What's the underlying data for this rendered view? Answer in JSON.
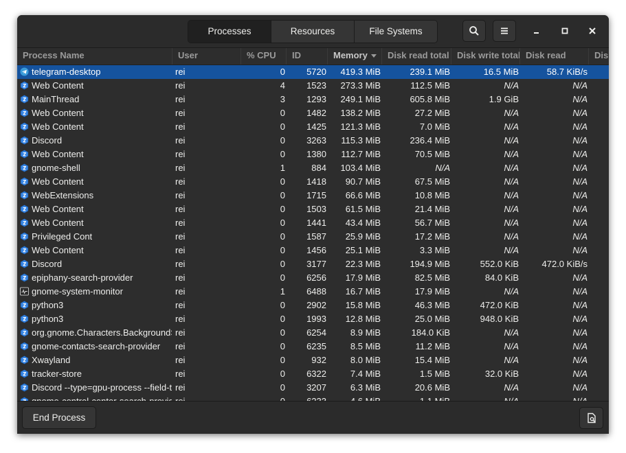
{
  "tabs": [
    "Processes",
    "Resources",
    "File Systems"
  ],
  "active_tab": "Processes",
  "header_buttons": {
    "search_icon": "search-icon",
    "menu_icon": "hamburger-menu-icon"
  },
  "window_controls": {
    "minimize": "minimize-icon",
    "maximize": "maximize-icon",
    "close": "close-icon"
  },
  "columns": [
    "Process Name",
    "User",
    "% CPU",
    "ID",
    "Memory",
    "Disk read total",
    "Disk write total",
    "Disk read",
    "Dis"
  ],
  "sorted_column": "Memory",
  "sort_direction": "descending",
  "colors": {
    "selection": "#15539e",
    "window_bg": "#2d2d2d",
    "text": "#eeeeec",
    "header_text": "#9b9b9b"
  },
  "rows": [
    {
      "name": "telegram-desktop",
      "user": "rei",
      "cpu": "0",
      "id": "5720",
      "memory": "419.3 MiB",
      "disk_read_total": "239.1 MiB",
      "disk_write_total": "16.5 MiB",
      "disk_read": "58.7 KiB/s",
      "icon": "telegram-icon",
      "selected": true
    },
    {
      "name": "Web Content",
      "user": "rei",
      "cpu": "4",
      "id": "1523",
      "memory": "273.3 MiB",
      "disk_read_total": "112.5 MiB",
      "disk_write_total": "N/A",
      "disk_read": "N/A",
      "icon": "generic-app-icon"
    },
    {
      "name": "MainThread",
      "user": "rei",
      "cpu": "3",
      "id": "1293",
      "memory": "249.1 MiB",
      "disk_read_total": "605.8 MiB",
      "disk_write_total": "1.9 GiB",
      "disk_read": "N/A",
      "icon": "generic-app-icon"
    },
    {
      "name": "Web Content",
      "user": "rei",
      "cpu": "0",
      "id": "1482",
      "memory": "138.2 MiB",
      "disk_read_total": "27.2 MiB",
      "disk_write_total": "N/A",
      "disk_read": "N/A",
      "icon": "generic-app-icon"
    },
    {
      "name": "Web Content",
      "user": "rei",
      "cpu": "0",
      "id": "1425",
      "memory": "121.3 MiB",
      "disk_read_total": "7.0 MiB",
      "disk_write_total": "N/A",
      "disk_read": "N/A",
      "icon": "generic-app-icon"
    },
    {
      "name": "Discord",
      "user": "rei",
      "cpu": "0",
      "id": "3263",
      "memory": "115.3 MiB",
      "disk_read_total": "236.4 MiB",
      "disk_write_total": "N/A",
      "disk_read": "N/A",
      "icon": "generic-app-icon"
    },
    {
      "name": "Web Content",
      "user": "rei",
      "cpu": "0",
      "id": "1380",
      "memory": "112.7 MiB",
      "disk_read_total": "70.5 MiB",
      "disk_write_total": "N/A",
      "disk_read": "N/A",
      "icon": "generic-app-icon"
    },
    {
      "name": "gnome-shell",
      "user": "rei",
      "cpu": "1",
      "id": "884",
      "memory": "103.4 MiB",
      "disk_read_total": "N/A",
      "disk_write_total": "N/A",
      "disk_read": "N/A",
      "icon": "generic-app-icon"
    },
    {
      "name": "Web Content",
      "user": "rei",
      "cpu": "0",
      "id": "1418",
      "memory": "90.7 MiB",
      "disk_read_total": "67.5 MiB",
      "disk_write_total": "N/A",
      "disk_read": "N/A",
      "icon": "generic-app-icon"
    },
    {
      "name": "WebExtensions",
      "user": "rei",
      "cpu": "0",
      "id": "1715",
      "memory": "66.6 MiB",
      "disk_read_total": "10.8 MiB",
      "disk_write_total": "N/A",
      "disk_read": "N/A",
      "icon": "generic-app-icon"
    },
    {
      "name": "Web Content",
      "user": "rei",
      "cpu": "0",
      "id": "1503",
      "memory": "61.5 MiB",
      "disk_read_total": "21.4 MiB",
      "disk_write_total": "N/A",
      "disk_read": "N/A",
      "icon": "generic-app-icon"
    },
    {
      "name": "Web Content",
      "user": "rei",
      "cpu": "0",
      "id": "1441",
      "memory": "43.4 MiB",
      "disk_read_total": "56.7 MiB",
      "disk_write_total": "N/A",
      "disk_read": "N/A",
      "icon": "generic-app-icon"
    },
    {
      "name": "Privileged Cont",
      "user": "rei",
      "cpu": "0",
      "id": "1587",
      "memory": "25.9 MiB",
      "disk_read_total": "17.2 MiB",
      "disk_write_total": "N/A",
      "disk_read": "N/A",
      "icon": "generic-app-icon"
    },
    {
      "name": "Web Content",
      "user": "rei",
      "cpu": "0",
      "id": "1456",
      "memory": "25.1 MiB",
      "disk_read_total": "3.3 MiB",
      "disk_write_total": "N/A",
      "disk_read": "N/A",
      "icon": "generic-app-icon"
    },
    {
      "name": "Discord",
      "user": "rei",
      "cpu": "0",
      "id": "3177",
      "memory": "22.3 MiB",
      "disk_read_total": "194.9 MiB",
      "disk_write_total": "552.0 KiB",
      "disk_read": "472.0 KiB/s",
      "icon": "generic-app-icon"
    },
    {
      "name": "epiphany-search-provider",
      "user": "rei",
      "cpu": "0",
      "id": "6256",
      "memory": "17.9 MiB",
      "disk_read_total": "82.5 MiB",
      "disk_write_total": "84.0 KiB",
      "disk_read": "N/A",
      "icon": "generic-app-icon"
    },
    {
      "name": "gnome-system-monitor",
      "user": "rei",
      "cpu": "1",
      "id": "6488",
      "memory": "16.7 MiB",
      "disk_read_total": "17.9 MiB",
      "disk_write_total": "N/A",
      "disk_read": "N/A",
      "icon": "system-monitor-icon"
    },
    {
      "name": "python3",
      "user": "rei",
      "cpu": "0",
      "id": "2902",
      "memory": "15.8 MiB",
      "disk_read_total": "46.3 MiB",
      "disk_write_total": "472.0 KiB",
      "disk_read": "N/A",
      "icon": "generic-app-icon"
    },
    {
      "name": "python3",
      "user": "rei",
      "cpu": "0",
      "id": "1993",
      "memory": "12.8 MiB",
      "disk_read_total": "25.0 MiB",
      "disk_write_total": "948.0 KiB",
      "disk_read": "N/A",
      "icon": "generic-app-icon"
    },
    {
      "name": "org.gnome.Characters.BackgroundService",
      "user": "rei",
      "cpu": "0",
      "id": "6254",
      "memory": "8.9 MiB",
      "disk_read_total": "184.0 KiB",
      "disk_write_total": "N/A",
      "disk_read": "N/A",
      "icon": "generic-app-icon"
    },
    {
      "name": "gnome-contacts-search-provider",
      "user": "rei",
      "cpu": "0",
      "id": "6235",
      "memory": "8.5 MiB",
      "disk_read_total": "11.2 MiB",
      "disk_write_total": "N/A",
      "disk_read": "N/A",
      "icon": "generic-app-icon"
    },
    {
      "name": "Xwayland",
      "user": "rei",
      "cpu": "0",
      "id": "932",
      "memory": "8.0 MiB",
      "disk_read_total": "15.4 MiB",
      "disk_write_total": "N/A",
      "disk_read": "N/A",
      "icon": "generic-app-icon"
    },
    {
      "name": "tracker-store",
      "user": "rei",
      "cpu": "0",
      "id": "6322",
      "memory": "7.4 MiB",
      "disk_read_total": "1.5 MiB",
      "disk_write_total": "32.0 KiB",
      "disk_read": "N/A",
      "icon": "generic-app-icon"
    },
    {
      "name": "Discord --type=gpu-process --field-trial-handle",
      "user": "rei",
      "cpu": "0",
      "id": "3207",
      "memory": "6.3 MiB",
      "disk_read_total": "20.6 MiB",
      "disk_write_total": "N/A",
      "disk_read": "N/A",
      "icon": "generic-app-icon"
    },
    {
      "name": "gnome-control-center-search-provider",
      "user": "rei",
      "cpu": "0",
      "id": "6233",
      "memory": "4.6 MiB",
      "disk_read_total": "1.1 MiB",
      "disk_write_total": "N/A",
      "disk_read": "N/A",
      "icon": "generic-app-icon"
    }
  ],
  "footer": {
    "end_process_label": "End Process",
    "properties_icon": "process-properties-icon"
  }
}
